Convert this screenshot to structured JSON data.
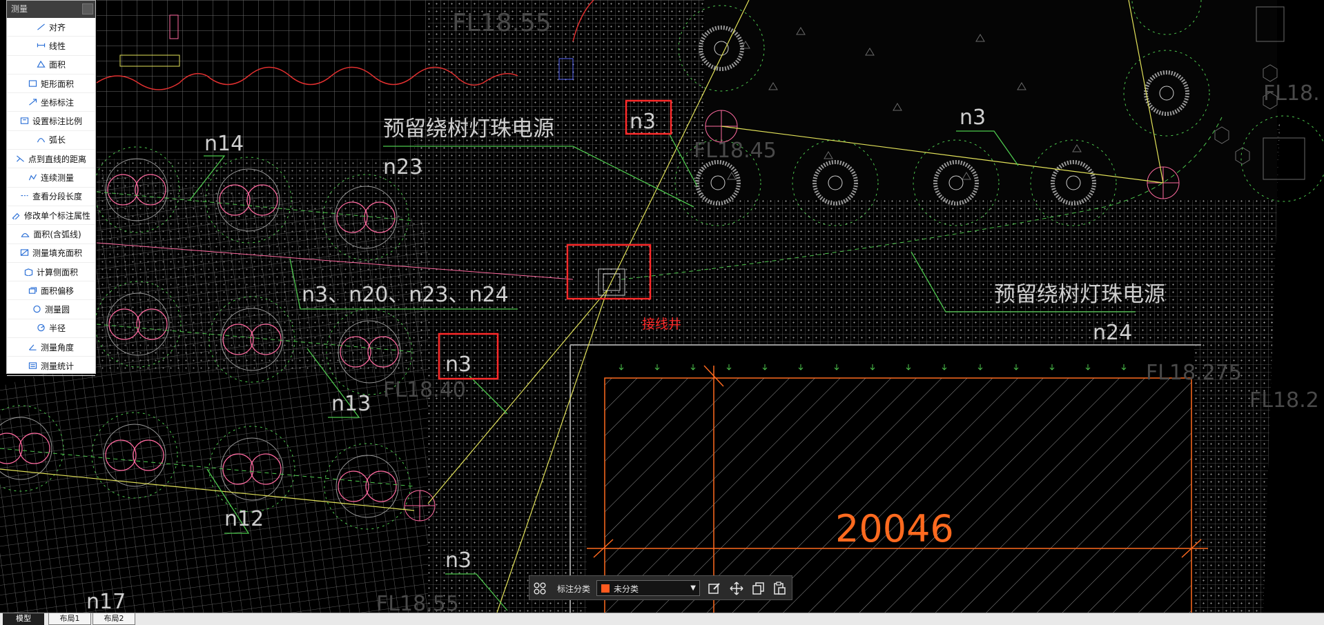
{
  "panel": {
    "title": "测量",
    "items": [
      {
        "label": "对齐",
        "icon": "align-icon"
      },
      {
        "label": "线性",
        "icon": "linear-icon"
      },
      {
        "label": "面积",
        "icon": "area-icon"
      },
      {
        "label": "矩形面积",
        "icon": "rect-area-icon"
      },
      {
        "label": "坐标标注",
        "icon": "coordinate-icon"
      },
      {
        "label": "设置标注比例",
        "icon": "scale-icon"
      },
      {
        "label": "弧长",
        "icon": "arc-icon"
      },
      {
        "label": "点到直线的距离",
        "icon": "point-line-icon"
      },
      {
        "label": "连续测量",
        "icon": "continuous-icon"
      },
      {
        "label": "查看分段长度",
        "icon": "segment-icon"
      },
      {
        "label": "修改单个标注属性",
        "icon": "edit-prop-icon"
      },
      {
        "label": "面积(含弧线)",
        "icon": "arc-area-icon"
      },
      {
        "label": "测量填充面积",
        "icon": "fill-area-icon"
      },
      {
        "label": "计算侧面积",
        "icon": "side-area-icon"
      },
      {
        "label": "面积偏移",
        "icon": "area-offset-icon"
      },
      {
        "label": "测量圆",
        "icon": "circle-icon"
      },
      {
        "label": "半径",
        "icon": "radius-icon"
      },
      {
        "label": "测量角度",
        "icon": "angle-icon"
      },
      {
        "label": "测量统计",
        "icon": "stats-icon"
      }
    ]
  },
  "drawing": {
    "labels": {
      "fl_top": "FL18.55",
      "fl_mid_left": "FL18.40",
      "fl_right_a": "FL18.275",
      "fl_right_b": "FL18.2",
      "fl_bottom": "FL18.55",
      "fl_upper_right": "FL18.45",
      "fl_far_right": "FL18.",
      "n14": "n14",
      "n23": "n23",
      "n3_boxed_top": "n3",
      "n3_right": "n3",
      "power_text_a": "预留绕树灯珠电源",
      "power_text_b": "预留绕树灯珠电源",
      "n24": "n24",
      "multi_label": "n3、n20、n23、n24",
      "n3_boxed_mid": "n3",
      "n13": "n13",
      "n12": "n12",
      "n3_bottom": "n3",
      "n17": "n17",
      "junction": "接线井",
      "dimension": "20046"
    }
  },
  "toolbar": {
    "classify_label": "标注分类",
    "selected": "未分类",
    "swatch_color": "#ff5a1f"
  },
  "tabs": [
    "模型",
    "布局1",
    "布局2"
  ],
  "colors": {
    "background": "#000000",
    "grid": "#8a8a8a",
    "tree_green": "#4ec94e",
    "highlight_red": "#ff2a2a",
    "leader_yellow": "#e3e35a",
    "pink": "#ff6aa0",
    "orange": "#ff6a1f"
  }
}
